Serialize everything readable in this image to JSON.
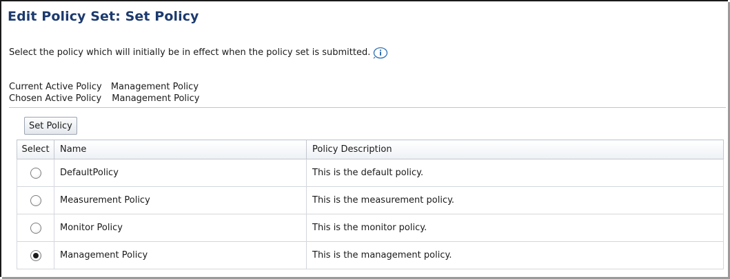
{
  "page": {
    "title": "Edit Policy Set: Set Policy",
    "instruction": "Select the policy which will initially be in effect when the policy set is submitted."
  },
  "summary": {
    "current_label": "Current Active Policy",
    "current_value": "Management Policy",
    "chosen_label": "Chosen Active Policy",
    "chosen_value": "Management Policy"
  },
  "toolbar": {
    "set_policy_label": "Set Policy"
  },
  "table": {
    "headers": [
      "Select",
      "Name",
      "Policy Description"
    ],
    "rows": [
      {
        "name": "DefaultPolicy",
        "description": "This is the default policy.",
        "selected": false
      },
      {
        "name": "Measurement Policy",
        "description": "This is the measurement policy.",
        "selected": false
      },
      {
        "name": "Monitor Policy",
        "description": "This is the monitor policy.",
        "selected": false
      },
      {
        "name": "Management Policy",
        "description": "This is the management policy.",
        "selected": true
      }
    ]
  },
  "colors": {
    "title": "#1c3a6e",
    "info_icon": "#2f6fb3"
  }
}
